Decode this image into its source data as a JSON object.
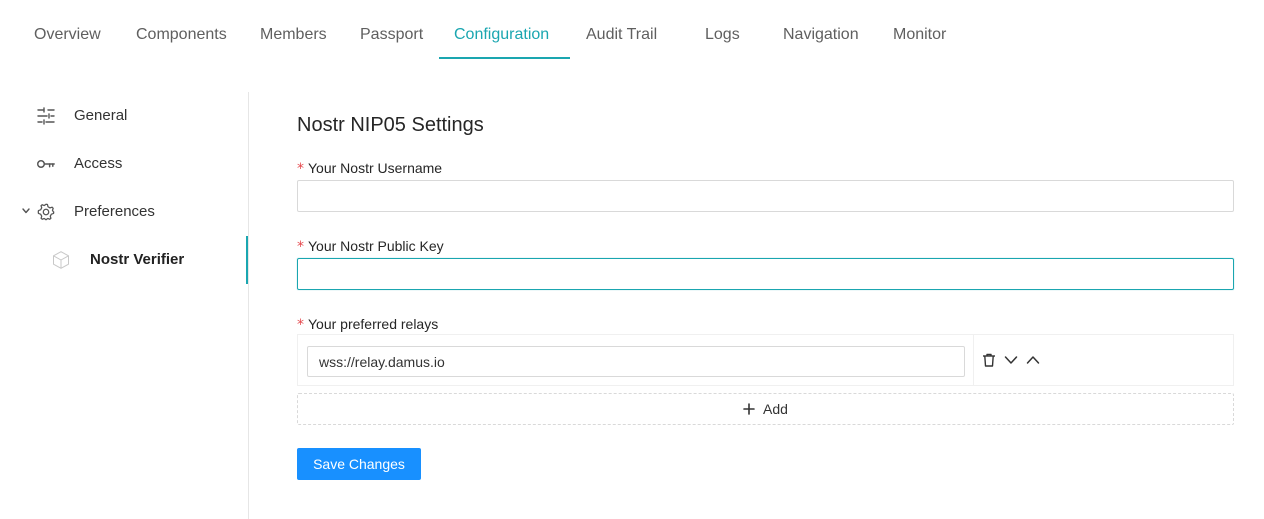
{
  "tabs": [
    {
      "label": "Overview",
      "active": false
    },
    {
      "label": "Components",
      "active": false
    },
    {
      "label": "Members",
      "active": false
    },
    {
      "label": "Passport",
      "active": false
    },
    {
      "label": "Configuration",
      "active": true
    },
    {
      "label": "Audit Trail",
      "active": false
    },
    {
      "label": "Logs",
      "active": false
    },
    {
      "label": "Navigation",
      "active": false
    },
    {
      "label": "Monitor",
      "active": false
    }
  ],
  "sidebar": {
    "items": [
      {
        "label": "General",
        "icon": "sliders-icon"
      },
      {
        "label": "Access",
        "icon": "key-icon"
      },
      {
        "label": "Preferences",
        "icon": "gear-icon",
        "expanded": true
      },
      {
        "label": "Nostr Verifier",
        "icon": "cube-icon",
        "selected": true
      }
    ]
  },
  "form": {
    "title": "Nostr NIP05 Settings",
    "required_mark": "*",
    "username": {
      "label": "Your Nostr Username",
      "value": ""
    },
    "public_key": {
      "label": "Your Nostr Public Key",
      "value": ""
    },
    "relays": {
      "label": "Your preferred relays",
      "items": [
        {
          "value": "wss://relay.damus.io"
        }
      ]
    },
    "add_label": "Add",
    "save_label": "Save Changes"
  },
  "colors": {
    "accent": "#1aa6b0",
    "primary_button": "#1890ff",
    "required": "#e5484d"
  }
}
